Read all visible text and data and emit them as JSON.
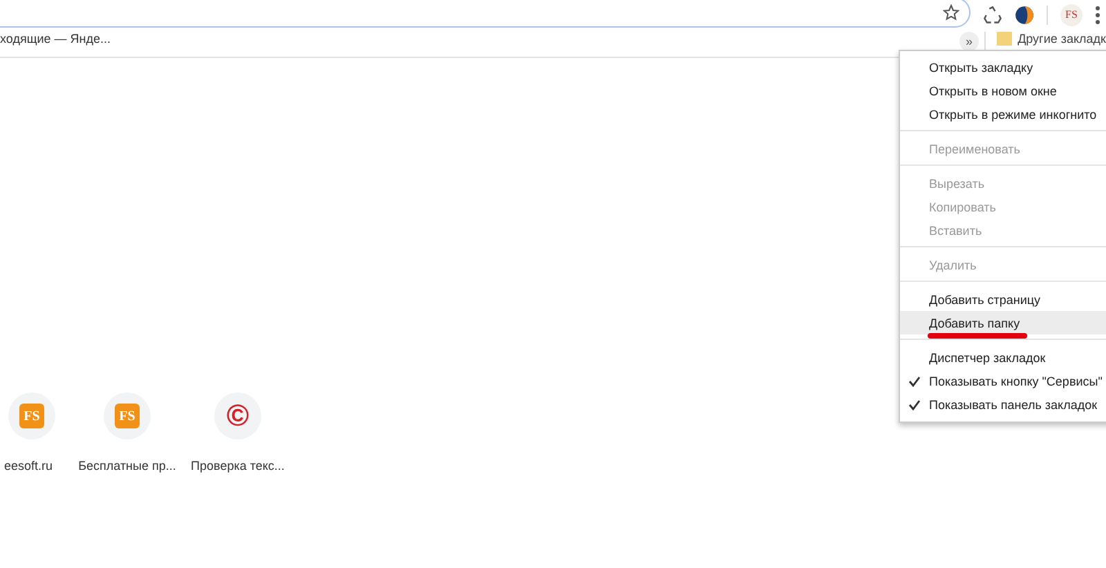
{
  "toolbar": {
    "extension_badge": "FS"
  },
  "bookmarks_bar": {
    "left_item": "ходящие — Янде...",
    "overflow": "»",
    "other_bookmarks": "Другие закладк"
  },
  "tiles": [
    {
      "label": "eesoft.ru",
      "logo": "FS",
      "kind": "fs"
    },
    {
      "label": "Бесплатные пр...",
      "logo": "FS",
      "kind": "fs"
    },
    {
      "label": "Проверка текс...",
      "logo": "©",
      "kind": "copyright"
    }
  ],
  "context_menu": [
    {
      "kind": "item",
      "label": "Открыть закладку",
      "disabled": false,
      "checked": false,
      "selected": false
    },
    {
      "kind": "item",
      "label": "Открыть в новом окне",
      "disabled": false,
      "checked": false,
      "selected": false
    },
    {
      "kind": "item",
      "label": "Открыть в режиме инкогнито",
      "disabled": false,
      "checked": false,
      "selected": false
    },
    {
      "kind": "separator"
    },
    {
      "kind": "item",
      "label": "Переименовать",
      "disabled": true,
      "checked": false,
      "selected": false
    },
    {
      "kind": "separator"
    },
    {
      "kind": "item",
      "label": "Вырезать",
      "disabled": true,
      "checked": false,
      "selected": false
    },
    {
      "kind": "item",
      "label": "Копировать",
      "disabled": true,
      "checked": false,
      "selected": false
    },
    {
      "kind": "item",
      "label": "Вставить",
      "disabled": true,
      "checked": false,
      "selected": false
    },
    {
      "kind": "separator"
    },
    {
      "kind": "item",
      "label": "Удалить",
      "disabled": true,
      "checked": false,
      "selected": false
    },
    {
      "kind": "separator"
    },
    {
      "kind": "item",
      "label": "Добавить страницу",
      "disabled": false,
      "checked": false,
      "selected": false
    },
    {
      "kind": "item",
      "label": "Добавить папку",
      "disabled": false,
      "checked": false,
      "selected": true,
      "underlined": true
    },
    {
      "kind": "separator"
    },
    {
      "kind": "item",
      "label": "Диспетчер закладок",
      "disabled": false,
      "checked": false,
      "selected": false
    },
    {
      "kind": "item",
      "label": "Показывать кнопку \"Сервисы\"",
      "disabled": false,
      "checked": true,
      "selected": false
    },
    {
      "kind": "item",
      "label": "Показывать панель закладок",
      "disabled": false,
      "checked": true,
      "selected": false
    }
  ]
}
